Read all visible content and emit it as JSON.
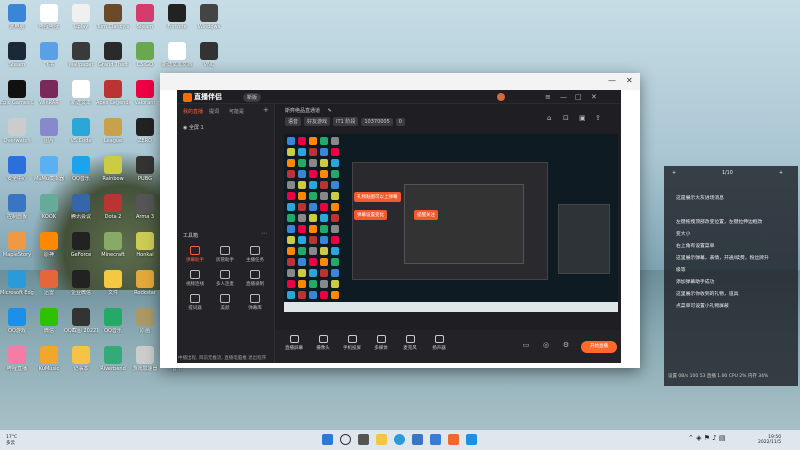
{
  "desktop": {
    "icons": [
      {
        "label": "此电脑",
        "color": "#3a85d8",
        "col": 0,
        "row": 0
      },
      {
        "label": "哔哩哔哩",
        "color": "#ffffff",
        "col": 1,
        "row": 0
      },
      {
        "label": "Uplay",
        "color": "#f0f0f0",
        "col": 2,
        "row": 0
      },
      {
        "label": "Tom Clancy's",
        "color": "#6b4a2a",
        "col": 3,
        "row": 0
      },
      {
        "label": "Steam",
        "color": "#d33c6b",
        "col": 4,
        "row": 0
      },
      {
        "label": "Fortnite",
        "color": "#222",
        "col": 5,
        "row": 0
      },
      {
        "label": "Windows",
        "color": "#444",
        "col": 6,
        "row": 0
      },
      {
        "label": "Steam",
        "color": "#1b2838",
        "col": 0,
        "row": 1
      },
      {
        "label": "飞书",
        "color": "#5aa0e6",
        "col": 1,
        "row": 1
      },
      {
        "label": "Wallpaper",
        "color": "#3a3a3a",
        "col": 2,
        "row": 1
      },
      {
        "label": "Grand Theft",
        "color": "#2a2a2a",
        "col": 3,
        "row": 1
      },
      {
        "label": "CS:GO",
        "color": "#6aa84f",
        "col": 4,
        "row": 1
      },
      {
        "label": "新建文本文档",
        "color": "#ffffff",
        "col": 5,
        "row": 1
      },
      {
        "label": "VNC",
        "color": "#333",
        "col": 6,
        "row": 1
      },
      {
        "label": "Epic Games Launcher",
        "color": "#111",
        "col": 0,
        "row": 2
      },
      {
        "label": "WinRAR",
        "color": "#7a2a5a",
        "col": 1,
        "row": 2
      },
      {
        "label": "新建文本",
        "color": "#fff",
        "col": 2,
        "row": 2
      },
      {
        "label": "Apex Legends",
        "color": "#b33",
        "col": 3,
        "row": 2
      },
      {
        "label": "Valorant",
        "color": "#e04",
        "col": 4,
        "row": 2
      },
      {
        "label": "Overwatch",
        "color": "#ccc",
        "col": 0,
        "row": 3
      },
      {
        "label": "图片",
        "color": "#88c",
        "col": 1,
        "row": 3
      },
      {
        "label": "VS Code",
        "color": "#2aa6d8",
        "col": 2,
        "row": 3
      },
      {
        "label": "League",
        "color": "#c8a24a",
        "col": 3,
        "row": 3
      },
      {
        "label": "ZERO",
        "color": "#222",
        "col": 4,
        "row": 3
      },
      {
        "label": "安全中心",
        "color": "#2a6fdb",
        "col": 0,
        "row": 4
      },
      {
        "label": "MuMu模拟器",
        "color": "#5ab0f0",
        "col": 1,
        "row": 4
      },
      {
        "label": "QQ音乐",
        "color": "#1ca3ec",
        "col": 2,
        "row": 4
      },
      {
        "label": "Rainbow",
        "color": "#cc4",
        "col": 3,
        "row": 4
      },
      {
        "label": "PUBG",
        "color": "#333",
        "col": 4,
        "row": 4
      },
      {
        "label": "控制面板",
        "color": "#3a75c4",
        "col": 0,
        "row": 5
      },
      {
        "label": "KOOK",
        "color": "#6a9",
        "col": 1,
        "row": 5
      },
      {
        "label": "腾讯会议",
        "color": "#36a",
        "col": 2,
        "row": 5
      },
      {
        "label": "Dota 2",
        "color": "#b33",
        "col": 3,
        "row": 5
      },
      {
        "label": "Arma 3",
        "color": "#555",
        "col": 4,
        "row": 5
      },
      {
        "label": "MapleStory",
        "color": "#e94",
        "col": 0,
        "row": 6
      },
      {
        "label": "原神",
        "color": "#f80",
        "col": 1,
        "row": 6
      },
      {
        "label": "GeForce",
        "color": "#222",
        "col": 2,
        "row": 6
      },
      {
        "label": "Minecraft",
        "color": "#8a6",
        "col": 3,
        "row": 6
      },
      {
        "label": "Honkai",
        "color": "#cc5",
        "col": 4,
        "row": 6
      },
      {
        "label": "Microsoft Edge",
        "color": "#2a9bd8",
        "col": 0,
        "row": 7
      },
      {
        "label": "迅雷",
        "color": "#e4663a",
        "col": 1,
        "row": 7
      },
      {
        "label": "企业微信",
        "color": "#222",
        "col": 2,
        "row": 7
      },
      {
        "label": "文件",
        "color": "#f5c842",
        "col": 3,
        "row": 7
      },
      {
        "label": "Rockstar",
        "color": "#e3a83a",
        "col": 4,
        "row": 7
      },
      {
        "label": "QQ游戏",
        "color": "#1c8fe8",
        "col": 0,
        "row": 8
      },
      {
        "label": "微信",
        "color": "#2dc100",
        "col": 1,
        "row": 8
      },
      {
        "label": "QQ截图 20221105",
        "color": "#333",
        "col": 2,
        "row": 8
      },
      {
        "label": "QQ音乐",
        "color": "#2a6",
        "col": 3,
        "row": 8
      },
      {
        "label": "原画",
        "color": "#a96",
        "col": 4,
        "row": 8
      },
      {
        "label": "哔哩直播",
        "color": "#f87aa5",
        "col": 0,
        "row": 9
      },
      {
        "label": "KuMusic",
        "color": "#f4a62a",
        "col": 1,
        "row": 9
      },
      {
        "label": "记事本",
        "color": "#f6c344",
        "col": 2,
        "row": 9
      },
      {
        "label": "Riverbend",
        "color": "#3a7",
        "col": 3,
        "row": 9
      },
      {
        "label": "游戏加速器",
        "color": "#ccc",
        "col": 4,
        "row": 9
      },
      {
        "label": "音乐",
        "color": "#e04",
        "col": 5,
        "row": 9
      }
    ]
  },
  "app": {
    "title": "直播伴侣",
    "version": "新版",
    "tabs": [
      "我的直播",
      "提词",
      "可能是"
    ],
    "scene": "全屏 1",
    "stream_title": "斯弈绝品直通道",
    "chips": [
      "语音",
      "好友游戏",
      "IT1 阶段",
      "10370005",
      "0"
    ],
    "tools_title": "工具箱",
    "tools": [
      {
        "label": "弹幕助手",
        "hot": true
      },
      {
        "label": "房管助手",
        "hot": false
      },
      {
        "label": "主播任务",
        "hot": false
      },
      {
        "label": "视频连线",
        "hot": false
      },
      {
        "label": "多人连麦",
        "hot": false
      },
      {
        "label": "直播录制",
        "hot": false
      },
      {
        "label": "提词器",
        "hot": false
      },
      {
        "label": "美颜",
        "hot": false
      },
      {
        "label": "弹幕库",
        "hot": false
      }
    ],
    "preview_toasts": [
      "礼物贴图可以上弹幕",
      "弹幕设置变化",
      "提醒关注"
    ],
    "bottom_tools": [
      "直播屏幕",
      "摄像头",
      "手机投屏",
      "多媒体",
      "麦克风",
      "扬声器"
    ],
    "live_button": "开始直播",
    "status_text": "中播出程, 目前无推流, 直播电脑推 退出程序"
  },
  "chat": {
    "header": [
      "+",
      "1/10",
      "+"
    ],
    "lines": [
      "这是展示大灰进场消息",
      "",
      "左键拖拽顶部改变位置，左键拉伸边框改",
      "变大小",
      "右上角有设置菜单",
      "这里展示弹幕，表情，开通/续费，粉丝牌升",
      "级等",
      "添加弹幕助手成功",
      "这里展示你收到的礼物，道具",
      "点菜单可设置小礼物屏蔽"
    ],
    "footer": "设置 0B/s  100  53   直播  1.00   CPU 2%  内存 34%"
  },
  "taskbar": {
    "left_line1": "17°C",
    "left_line2": "多云",
    "time": "19:50",
    "date": "2022/11/5"
  }
}
